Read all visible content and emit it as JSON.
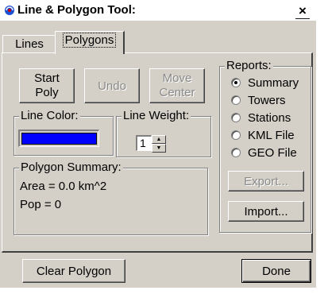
{
  "window": {
    "title": "Line & Polygon Tool:",
    "close_glyph": "×"
  },
  "tabs": [
    {
      "label": "Lines"
    },
    {
      "label": "Polygons"
    }
  ],
  "buttons": {
    "start_poly": [
      "Start",
      "Poly"
    ],
    "undo": "Undo",
    "move_center": [
      "Move",
      "Center"
    ],
    "export": "Export...",
    "import": "Import...",
    "clear_polygon": "Clear Polygon",
    "done": "Done"
  },
  "line_color": {
    "label": "Line Color:",
    "color": "#0000ff"
  },
  "line_weight": {
    "label": "Line Weight:",
    "value": "1"
  },
  "polygon_summary": {
    "label": "Polygon Summary:",
    "area": "Area = 0.0 km^2",
    "pop": "Pop = 0"
  },
  "reports": {
    "label": "Reports:",
    "options": [
      {
        "label": "Summary",
        "checked": true
      },
      {
        "label": "Towers",
        "checked": false
      },
      {
        "label": "Stations",
        "checked": false
      },
      {
        "label": "KML File",
        "checked": false
      },
      {
        "label": "GEO File",
        "checked": false
      }
    ]
  }
}
